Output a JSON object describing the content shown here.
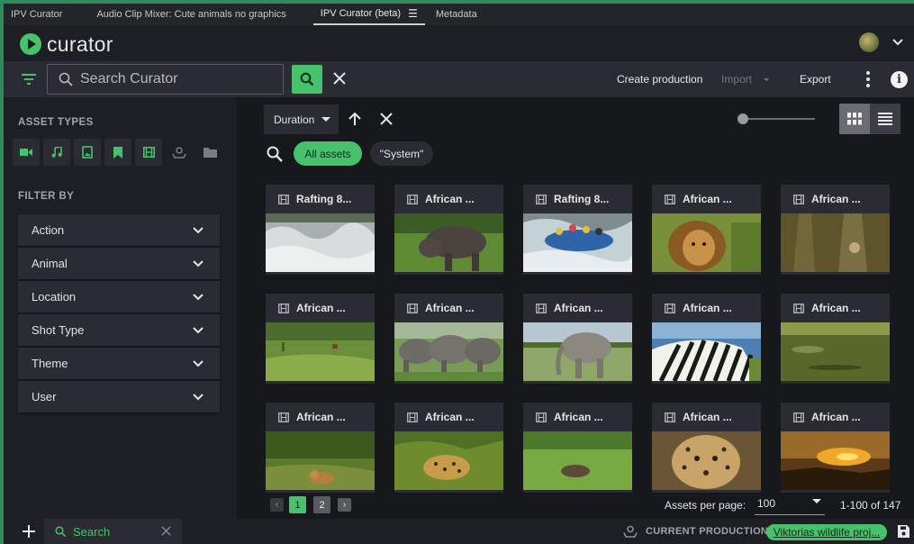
{
  "tabs": [
    {
      "label": "IPV Curator"
    },
    {
      "label": "Audio Clip Mixer: Cute animals no graphics"
    },
    {
      "label": "IPV Curator (beta)",
      "menu": "☰"
    },
    {
      "label": "Metadata"
    }
  ],
  "header": {
    "app_name": "curator"
  },
  "toolbar": {
    "search_placeholder": "Search Curator",
    "create_production": "Create production",
    "import": "Import",
    "export": "Export",
    "info": "i"
  },
  "sidebar": {
    "asset_types_title": "ASSET TYPES",
    "asset_types": [
      "video-icon",
      "audio-icon",
      "image-icon",
      "bookmark-icon",
      "film-icon",
      "production-icon",
      "folder-icon"
    ],
    "filter_by_title": "FILTER BY",
    "filters": [
      "Action",
      "Animal",
      "Location",
      "Shot Type",
      "Theme",
      "User"
    ]
  },
  "main": {
    "sort_label": "Duration",
    "chips": {
      "all_assets": "All assets",
      "system": "\"System\""
    },
    "assets": [
      {
        "title": "Rafting 8...",
        "scene": "water"
      },
      {
        "title": "African ...",
        "scene": "rhino"
      },
      {
        "title": "Rafting 8...",
        "scene": "raft"
      },
      {
        "title": "African ...",
        "scene": "lion"
      },
      {
        "title": "African ...",
        "scene": "tree"
      },
      {
        "title": "African ...",
        "scene": "field"
      },
      {
        "title": "African ...",
        "scene": "elephants"
      },
      {
        "title": "African ...",
        "scene": "elephant"
      },
      {
        "title": "African ...",
        "scene": "zebra"
      },
      {
        "title": "African ...",
        "scene": "croc"
      },
      {
        "title": "African ...",
        "scene": "lioness"
      },
      {
        "title": "African ...",
        "scene": "leopard"
      },
      {
        "title": "African ...",
        "scene": "grass"
      },
      {
        "title": "African ...",
        "scene": "cheetah"
      },
      {
        "title": "African ...",
        "scene": "sunset"
      }
    ],
    "pagination": {
      "prev": "‹",
      "pages": [
        "1",
        "2"
      ],
      "next": "›",
      "current": "1"
    },
    "per_page_label": "Assets per page:",
    "per_page_value": "100",
    "range": "1-100 of 147"
  },
  "bottombar": {
    "search_tab": "Search",
    "current_production_label": "CURRENT PRODUCTION",
    "current_production": "Viktorias wildlife proj..."
  },
  "colors": {
    "accent": "#47c16c",
    "panel": "#2b2c33",
    "bg": "#1e1f24"
  }
}
